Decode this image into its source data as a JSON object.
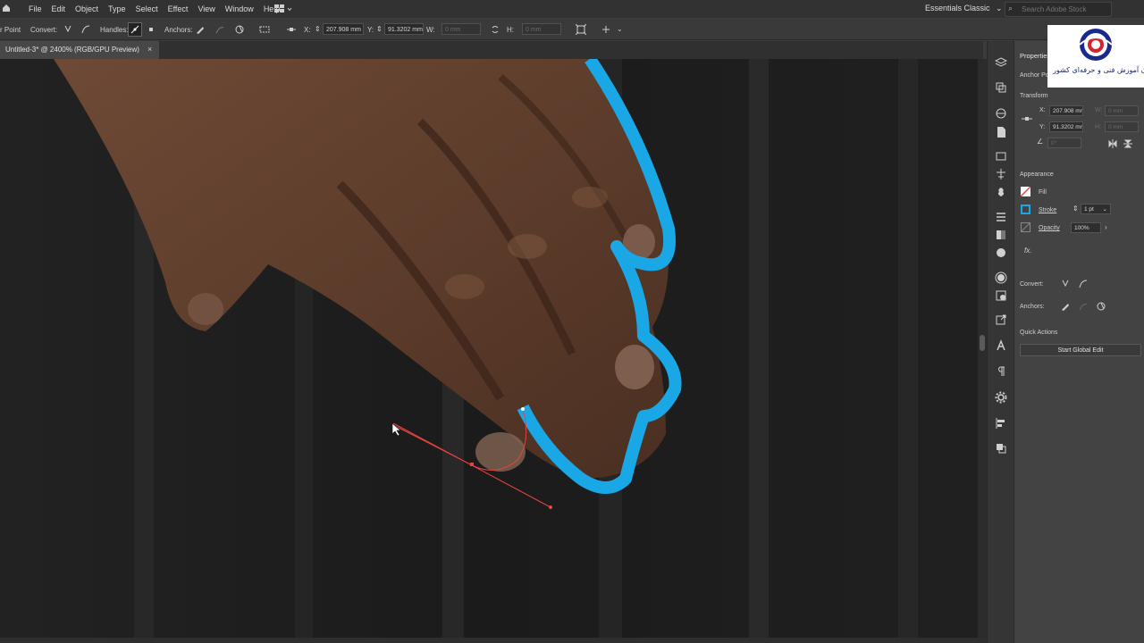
{
  "menubar": {
    "items": [
      "File",
      "Edit",
      "Object",
      "Type",
      "Select",
      "Effect",
      "View",
      "Window",
      "Help"
    ],
    "workspace": "Essentials Classic",
    "search_placeholder": "Search Adobe Stock"
  },
  "controlbar": {
    "tool_label": "r Point",
    "convert_label": "Convert:",
    "handles_label": "Handles:",
    "anchors_label": "Anchors:",
    "x_label": "X:",
    "x_value": "207.908 mm",
    "y_label": "Y:",
    "y_value": "91.3202 mm",
    "w_label": "W:",
    "w_value": "0 mm",
    "h_label": "H:",
    "h_value": "0 mm"
  },
  "document": {
    "tab_title": "Untitled-3* @ 2400% (RGB/GPU Preview)",
    "tab_close": "×"
  },
  "properties": {
    "title": "Properties",
    "anchor_label": "Anchor Po",
    "transform_label": "Transform",
    "x_label": "X:",
    "x_value": "207.908 mr",
    "y_label": "Y:",
    "y_value": "91.3202 mr",
    "w_label": "W:",
    "w_value": "0 mm",
    "h_label": "H:",
    "h_value": "0 mm",
    "angle_value": "0°",
    "appearance_label": "Appearance",
    "fill_label": "Fill",
    "stroke_label": "Stroke",
    "stroke_value": "1 pt",
    "opacity_label": "Opacity",
    "opacity_value": "100%",
    "fx_label": "fx.",
    "convert_label": "Convert:",
    "anchors_label": "Anchors:",
    "quick_actions_label": "Quick Actions",
    "global_edit_label": "Start Global Edit"
  },
  "logo": {
    "text": "سازمان آموزش فنی و حرفه‌ای کشور"
  },
  "colors": {
    "path_stroke": "#1aa7e6",
    "selection_red": "#e8433f",
    "logo_blue": "#1a2a8c",
    "logo_red": "#d4232a"
  }
}
